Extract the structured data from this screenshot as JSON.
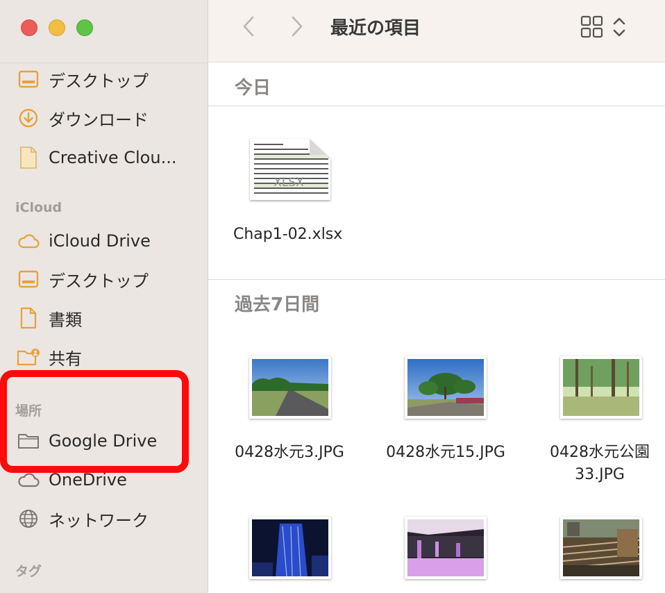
{
  "window": {
    "title": "最近の項目"
  },
  "sidebar": {
    "favorites": [
      {
        "label": "デスクトップ",
        "icon": "desktop-icon"
      },
      {
        "label": "ダウンロード",
        "icon": "download-icon"
      },
      {
        "label": "Creative Clou...",
        "icon": "document-icon"
      }
    ],
    "icloud_header": "iCloud",
    "icloud": [
      {
        "label": "iCloud Drive",
        "icon": "cloud-icon"
      },
      {
        "label": "デスクトップ",
        "icon": "desktop-icon"
      },
      {
        "label": "書類",
        "icon": "document-icon"
      },
      {
        "label": "共有",
        "icon": "shared-folder-icon"
      }
    ],
    "locations_header": "場所",
    "locations": [
      {
        "label": "Google Drive",
        "icon": "folder-icon"
      },
      {
        "label": "OneDrive",
        "icon": "cloud-icon"
      },
      {
        "label": "ネットワーク",
        "icon": "globe-icon"
      }
    ],
    "tags_header": "タグ"
  },
  "sections": {
    "today": "今日",
    "past7": "過去7日間"
  },
  "files_today": [
    {
      "name": "Chap1-02.xlsx",
      "kind": "xlsx",
      "badge": "XLSX"
    }
  ],
  "files_past7": [
    {
      "name_line1": "0428水元3.JPG",
      "name_line2": ""
    },
    {
      "name_line1": "0428水元15.JPG",
      "name_line2": ""
    },
    {
      "name_line1": "0428水元公園",
      "name_line2": "33.JPG"
    }
  ],
  "colors": {
    "sidebar_bg": "#ebe6e2",
    "accent_icon": "#e8a13a",
    "highlight": "#ff0a0a"
  }
}
